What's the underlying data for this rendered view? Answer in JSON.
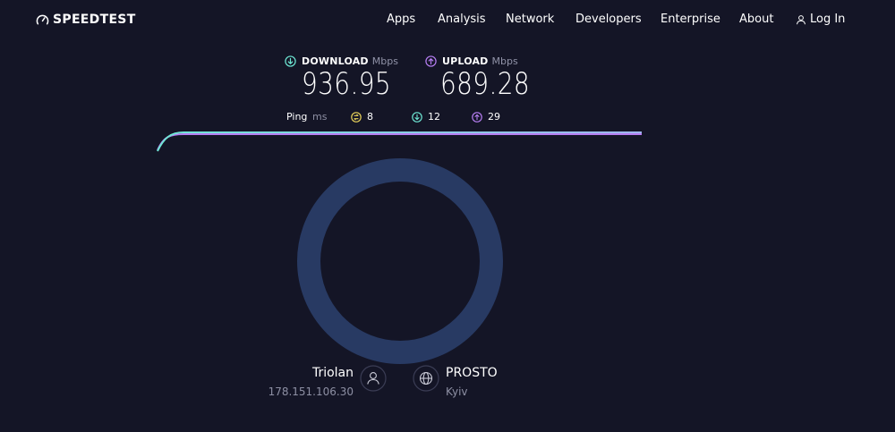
{
  "brand": {
    "name": "SPEEDTEST",
    "icon": "speedometer-icon"
  },
  "nav": {
    "items": [
      {
        "label": "Apps"
      },
      {
        "label": "Analysis"
      },
      {
        "label": "Network"
      },
      {
        "label": "Developers"
      },
      {
        "label": "Enterprise"
      },
      {
        "label": "About"
      }
    ],
    "login_label": "Log In",
    "login_icon": "user-icon"
  },
  "results": {
    "download": {
      "label": "DOWNLOAD",
      "unit": "Mbps",
      "value": "936.95",
      "icon": "download-arrow-icon",
      "color": "#6ee7d4"
    },
    "upload": {
      "label": "UPLOAD",
      "unit": "Mbps",
      "value": "689.28",
      "icon": "upload-arrow-icon",
      "color": "#b67ef2"
    },
    "ping": {
      "label": "Ping",
      "unit": "ms",
      "idle": {
        "value": "8",
        "icon": "ping-idle-icon",
        "color": "#e8d25a"
      },
      "download": {
        "value": "12",
        "icon": "ping-download-icon",
        "color": "#6ee7d4"
      },
      "upload": {
        "value": "29",
        "icon": "ping-upload-icon",
        "color": "#b67ef2"
      }
    }
  },
  "server": {
    "isp_name": "Triolan",
    "ip": "178.151.106.30",
    "isp_icon": "user-icon",
    "host_name": "PROSTO",
    "host_location": "Kyiv",
    "host_icon": "globe-icon"
  },
  "colors": {
    "background": "#141526",
    "gauge_ring": "#283a63",
    "download": "#6ee7d4",
    "upload": "#b67ef2",
    "muted_text": "#8d8fa3"
  }
}
